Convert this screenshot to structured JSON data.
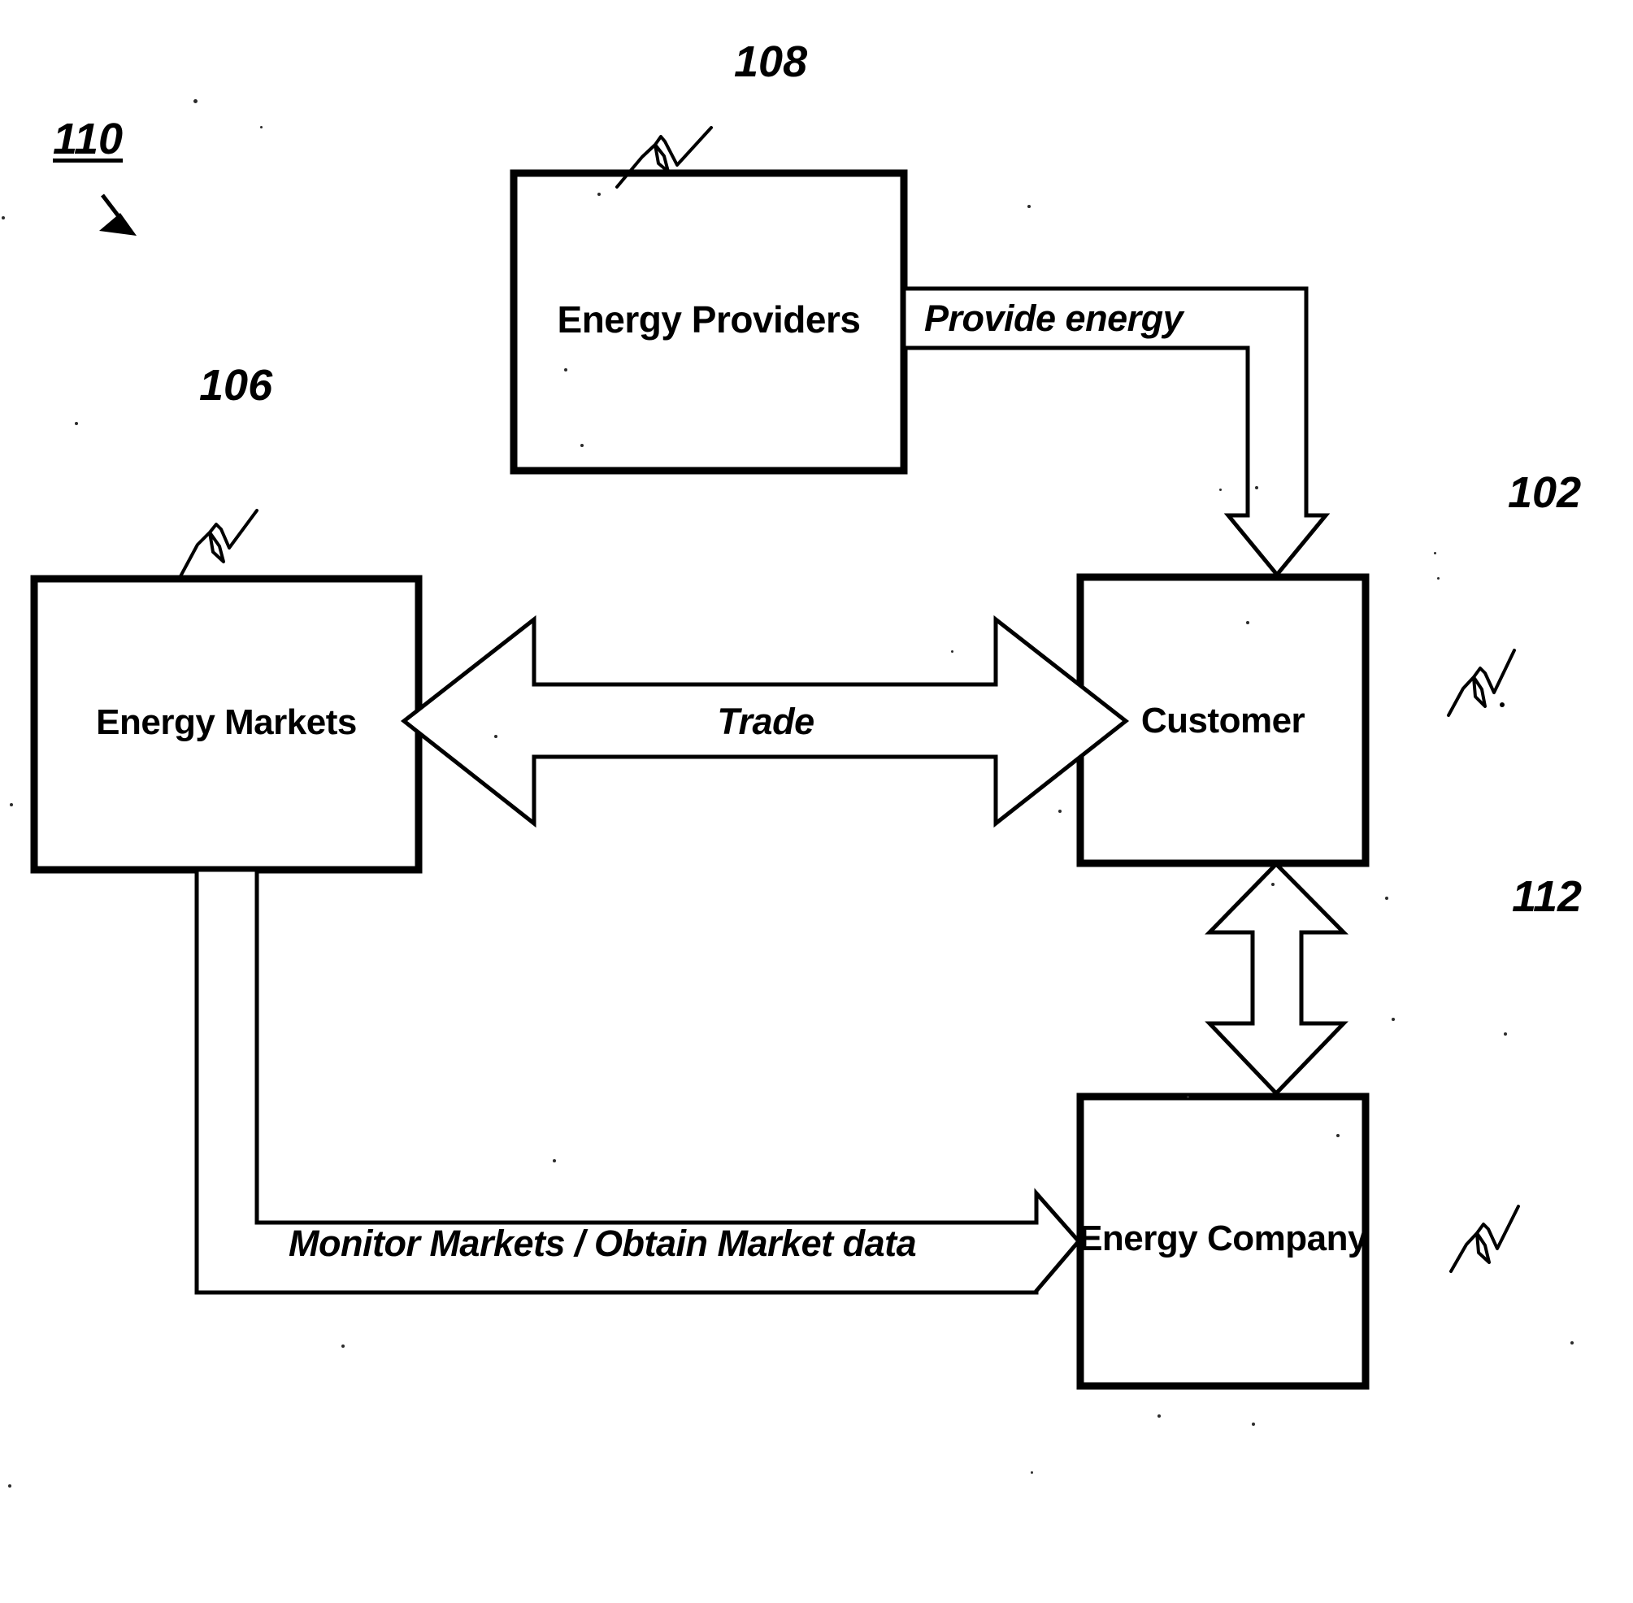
{
  "figure": {
    "title": "Energy trading and supply block diagram",
    "background_color": "#ffffff",
    "line_color": "#000000"
  },
  "boxes": [
    {
      "id": "energy-providers",
      "label": "Energy Providers",
      "ref": "108"
    },
    {
      "id": "energy-markets",
      "label": "Energy Markets",
      "ref": "106"
    },
    {
      "id": "customer",
      "label": "Customer",
      "ref": "102"
    },
    {
      "id": "energy-company",
      "label": "Energy Company",
      "ref": "112"
    }
  ],
  "connectors": [
    {
      "id": "provide-energy",
      "label": "Provide energy",
      "from": "energy-providers",
      "to": "customer",
      "direction": "one-way"
    },
    {
      "id": "trade",
      "label": "Trade",
      "from": "energy-markets",
      "to": "customer",
      "direction": "bidirectional"
    },
    {
      "id": "customer-company",
      "label": "",
      "from": "customer",
      "to": "energy-company",
      "direction": "bidirectional"
    },
    {
      "id": "monitor-markets",
      "label": "Monitor Markets / Obtain Market data",
      "from": "energy-markets",
      "to": "energy-company",
      "direction": "one-way"
    }
  ],
  "reference_numerals": {
    "figure": "110",
    "customer": "102",
    "energy_markets": "106",
    "energy_providers": "108",
    "energy_company": "112"
  },
  "labels": {
    "energy_providers": "Energy Providers",
    "energy_markets": "Energy Markets",
    "customer": "Customer",
    "energy_company": "Energy Company",
    "provide_energy": "Provide energy",
    "trade": "Trade",
    "monitor_markets": "Monitor Markets / Obtain Market data"
  }
}
